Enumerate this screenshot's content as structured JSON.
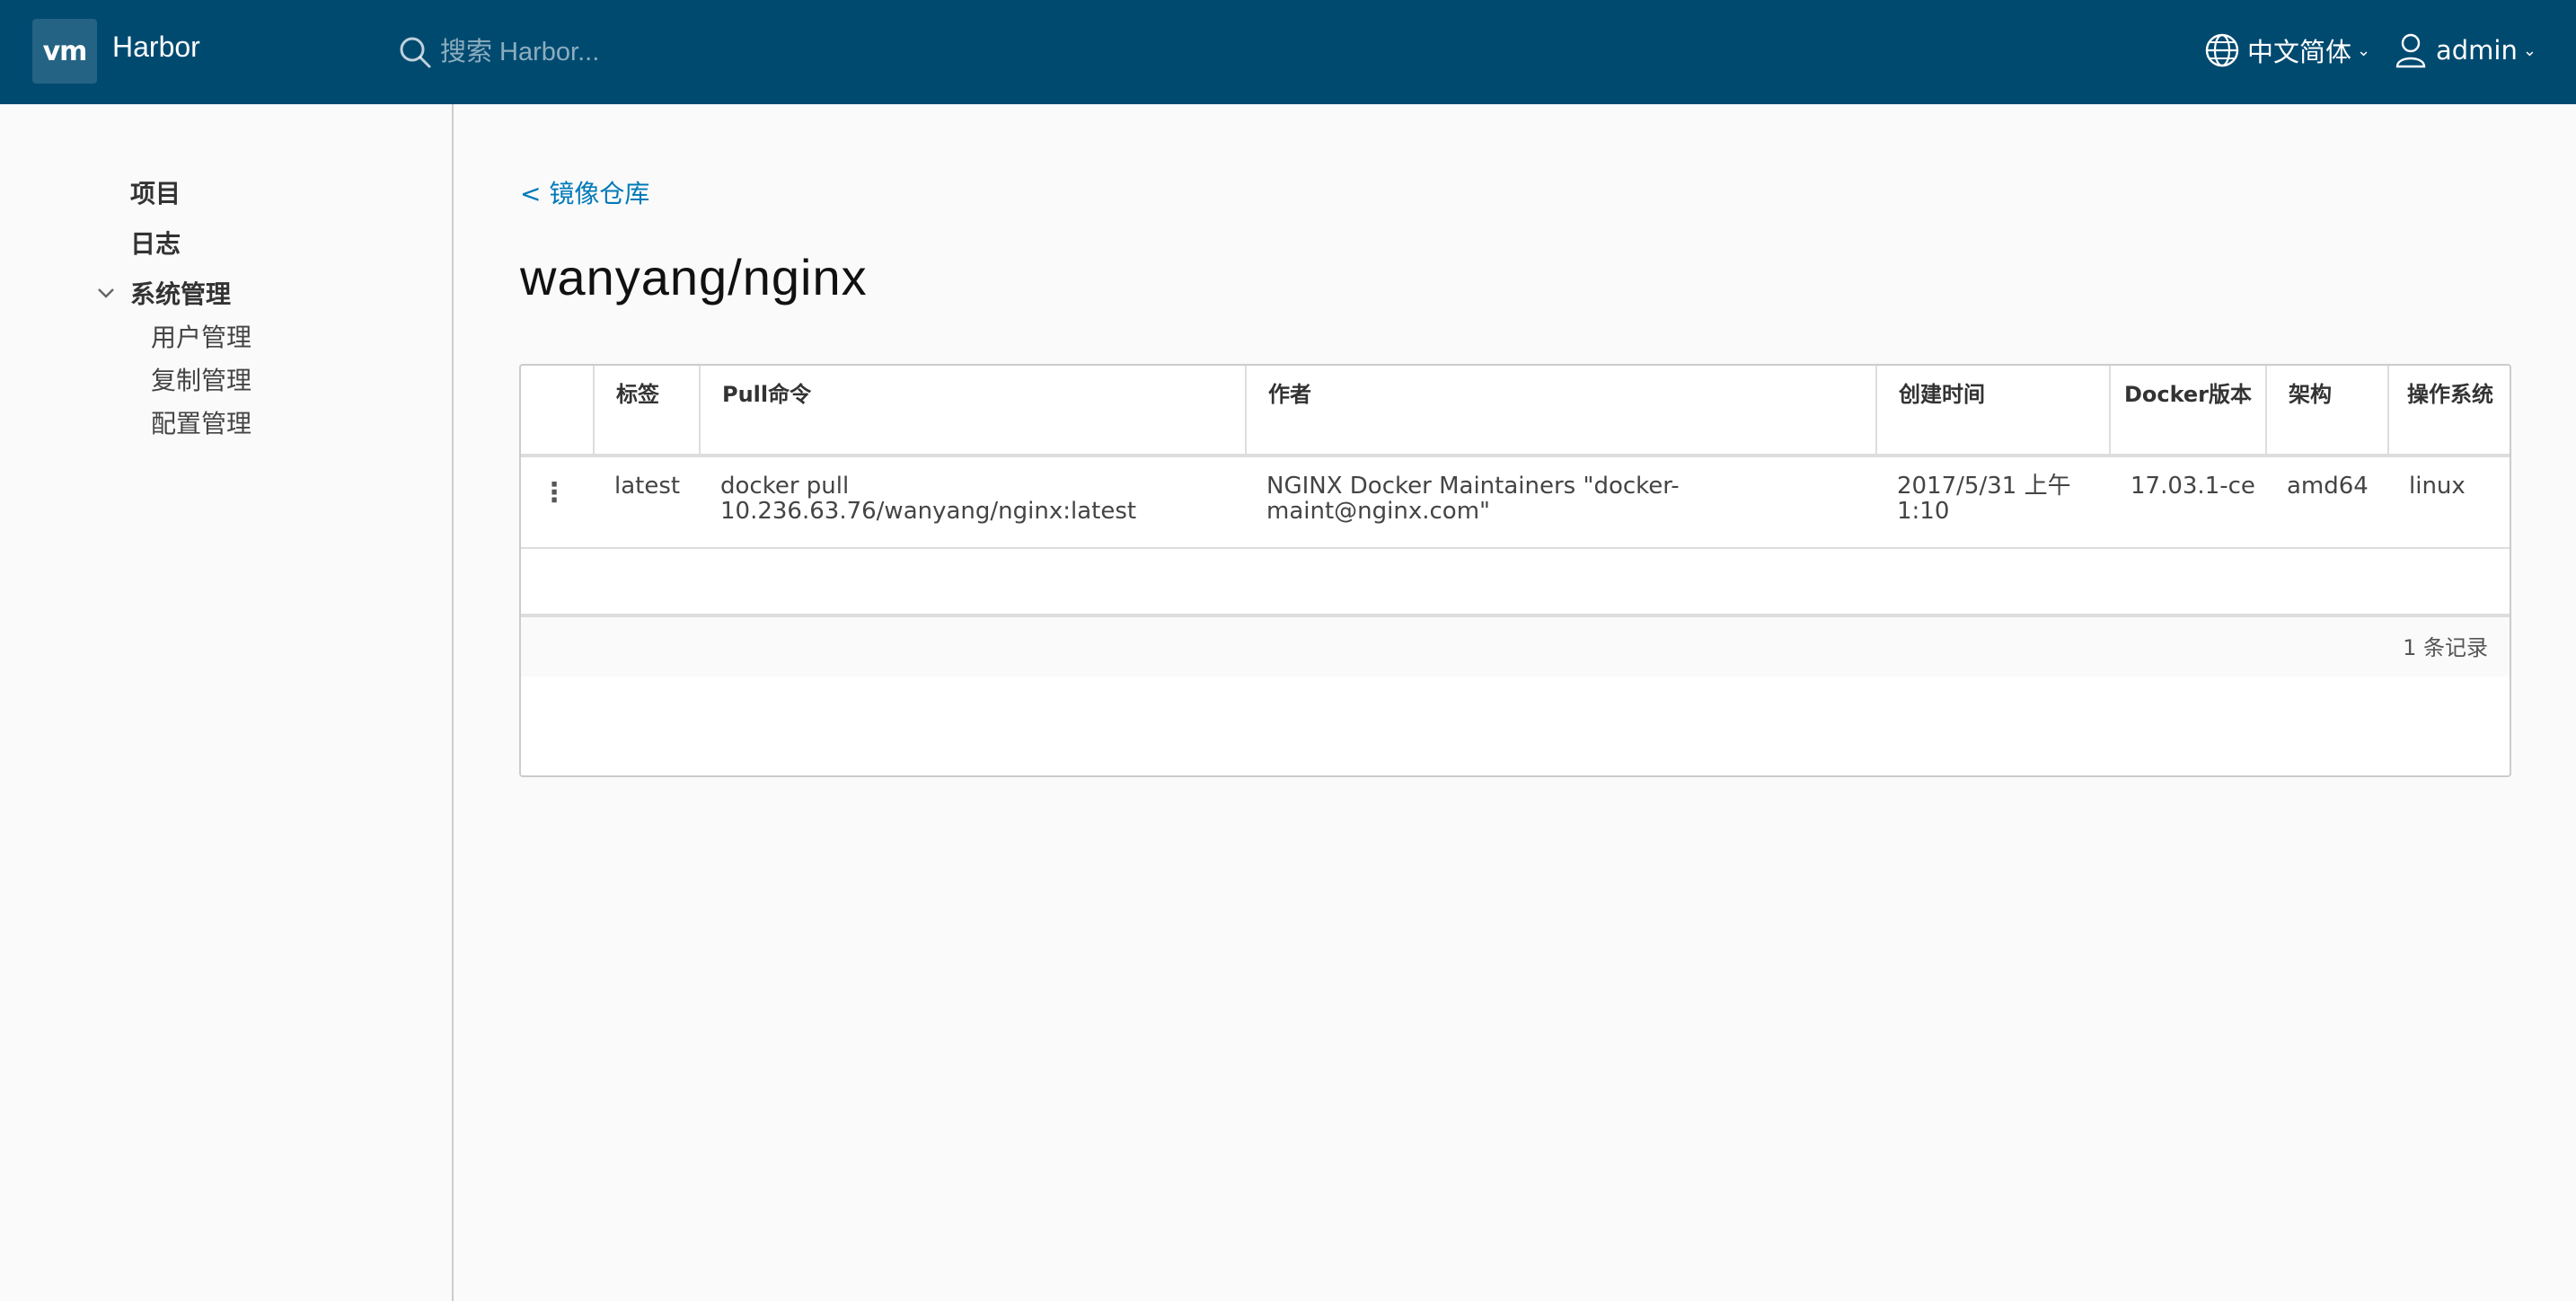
{
  "header": {
    "logo_text": "vm",
    "app_title": "Harbor",
    "search_placeholder": "搜索 Harbor...",
    "language": "中文简体",
    "user": "admin",
    "background_color": "#004a70"
  },
  "sidebar": {
    "items": [
      {
        "label": "项目"
      },
      {
        "label": "日志"
      },
      {
        "label": "系统管理"
      }
    ],
    "sub_items": [
      {
        "label": "用户管理"
      },
      {
        "label": "复制管理"
      },
      {
        "label": "配置管理"
      }
    ]
  },
  "main": {
    "back_link": "< 镜像仓库",
    "title": "wanyang/nginx",
    "table": {
      "columns": [
        "标签",
        "Pull命令",
        "作者",
        "创建时间",
        "Docker版本",
        "架构",
        "操作系统"
      ],
      "rows": [
        {
          "tag": "latest",
          "pull_command": "docker pull 10.236.63.76/wanyang/nginx:latest",
          "author": "NGINX Docker Maintainers \"docker-maint@nginx.com\"",
          "created": "2017/5/31 上午1:10",
          "docker_version": "17.03.1-ce",
          "arch": "amd64",
          "os": "linux"
        }
      ],
      "footer": "1 条记录"
    }
  }
}
